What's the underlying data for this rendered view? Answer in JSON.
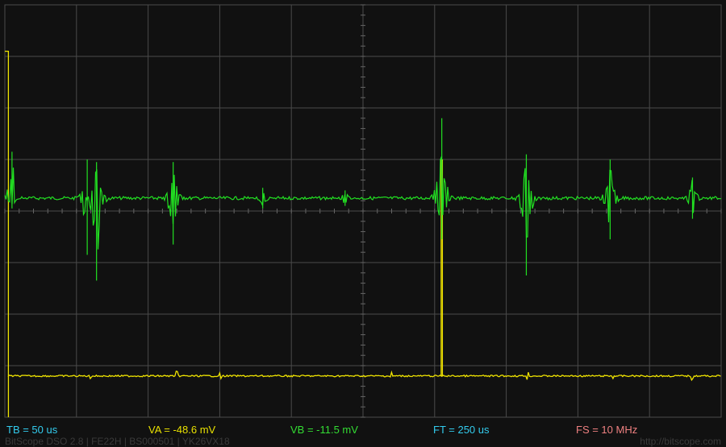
{
  "readouts": {
    "tb": "TB = 50 us",
    "va": "VA = -48.6 mV",
    "vb": "VB = -11.5 mV",
    "ft": "FT = 250 us",
    "fs": "FS = 10 MHz"
  },
  "footer": {
    "left": "BitScope DSO 2.8 | FE22H | BS000501 | YK26VX18",
    "right": "http://bitscope.com"
  },
  "colors": {
    "background": "#111111",
    "grid": "#4a4a4a",
    "channel_a": "#f0e400",
    "channel_b": "#22e022",
    "tb": "#33ccee",
    "va": "#e8e000",
    "vb": "#33dd33",
    "ft": "#33ccee",
    "fs": "#ee8080"
  },
  "chart_data": {
    "type": "line",
    "grid": true,
    "x_divisions": 10,
    "y_divisions": 8,
    "series": [
      {
        "channel": "A",
        "color": "#f0e400",
        "baseline_div": -3.2,
        "step_high_div": 3.1,
        "pulses": [
          {
            "t_div": 0.05,
            "fall_to_div": -3.2
          },
          {
            "t_div": 6.1,
            "rise_to_div": 1.0,
            "fall_to_div": -3.2
          }
        ],
        "glitch_times_div": [
          1.2,
          2.4,
          3.0,
          5.4,
          6.1,
          7.3,
          8.5,
          9.6
        ]
      },
      {
        "channel": "B",
        "color": "#22e022",
        "baseline_div": 0.25,
        "bursts": [
          {
            "t_div": 0.1,
            "up_div": 0.9,
            "down_div": -0.2
          },
          {
            "t_div": 1.15,
            "up_div": 0.75,
            "down_div": -1.1
          },
          {
            "t_div": 1.28,
            "up_div": 0.7,
            "down_div": -1.6
          },
          {
            "t_div": 2.35,
            "up_div": 0.7,
            "down_div": -0.9
          },
          {
            "t_div": 3.6,
            "up_div": 0.2,
            "down_div": -0.2
          },
          {
            "t_div": 4.75,
            "up_div": 0.15,
            "down_div": -0.15
          },
          {
            "t_div": 6.1,
            "up_div": 1.55,
            "down_div": -0.8
          },
          {
            "t_div": 7.28,
            "up_div": 0.85,
            "down_div": -1.5
          },
          {
            "t_div": 8.45,
            "up_div": 0.75,
            "down_div": -0.8
          },
          {
            "t_div": 9.6,
            "up_div": 0.4,
            "down_div": -0.4
          }
        ]
      }
    ]
  }
}
